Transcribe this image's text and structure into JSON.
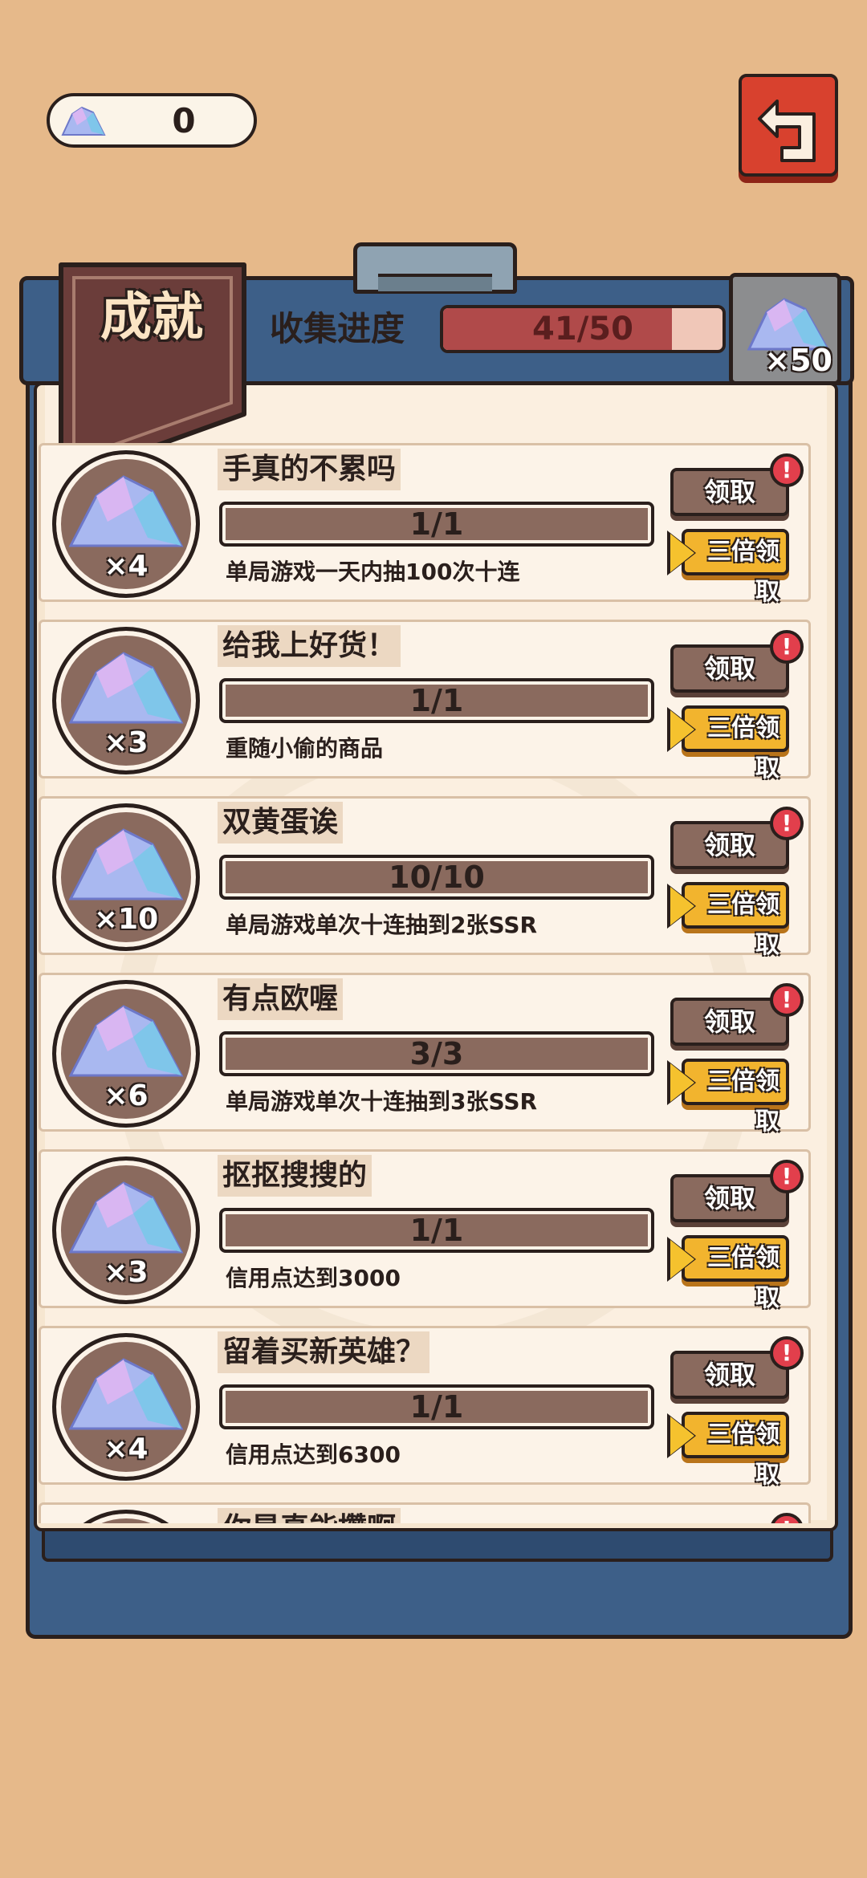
{
  "currency": {
    "icon": "crystal-icon",
    "value": "0"
  },
  "back_button": {
    "icon": "return-arrow-icon"
  },
  "header": {
    "title": "成就",
    "progress_label": "收集进度",
    "progress_text": "41/50",
    "progress_fraction": 0.82,
    "reward": {
      "icon": "crystal-icon",
      "quantity": "×50"
    }
  },
  "achievements": [
    {
      "reward_count": "×4",
      "title": "手真的不累吗",
      "progress": "1/1",
      "description": "单局游戏一天内抽100次十连",
      "claim_label": "领取",
      "triple_label": "三倍领取",
      "alert": "!"
    },
    {
      "reward_count": "×3",
      "title": "给我上好货！",
      "progress": "1/1",
      "description": "重随小偷的商品",
      "claim_label": "领取",
      "triple_label": "三倍领取",
      "alert": "!"
    },
    {
      "reward_count": "×10",
      "title": "双黄蛋诶",
      "progress": "10/10",
      "description": "单局游戏单次十连抽到2张SSR",
      "claim_label": "领取",
      "triple_label": "三倍领取",
      "alert": "!"
    },
    {
      "reward_count": "×6",
      "title": "有点欧喔",
      "progress": "3/3",
      "description": "单局游戏单次十连抽到3张SSR",
      "claim_label": "领取",
      "triple_label": "三倍领取",
      "alert": "!"
    },
    {
      "reward_count": "×3",
      "title": "抠抠搜搜的",
      "progress": "1/1",
      "description": "信用点达到3000",
      "claim_label": "领取",
      "triple_label": "三倍领取",
      "alert": "!"
    },
    {
      "reward_count": "×4",
      "title": "留着买新英雄？",
      "progress": "1/1",
      "description": "信用点达到6300",
      "claim_label": "领取",
      "triple_label": "三倍领取",
      "alert": "!"
    },
    {
      "reward_count": "",
      "title": "你是真能攒啊",
      "progress": "",
      "description": "",
      "claim_label": "",
      "triple_label": "",
      "alert": "!"
    }
  ],
  "colors": {
    "background": "#e6b98a",
    "board": "#3d5f88",
    "progress_fill": "#b04a4a",
    "claim_button": "#8a6a5e",
    "triple_button": "#f2b42e",
    "alert": "#e23f4c"
  }
}
